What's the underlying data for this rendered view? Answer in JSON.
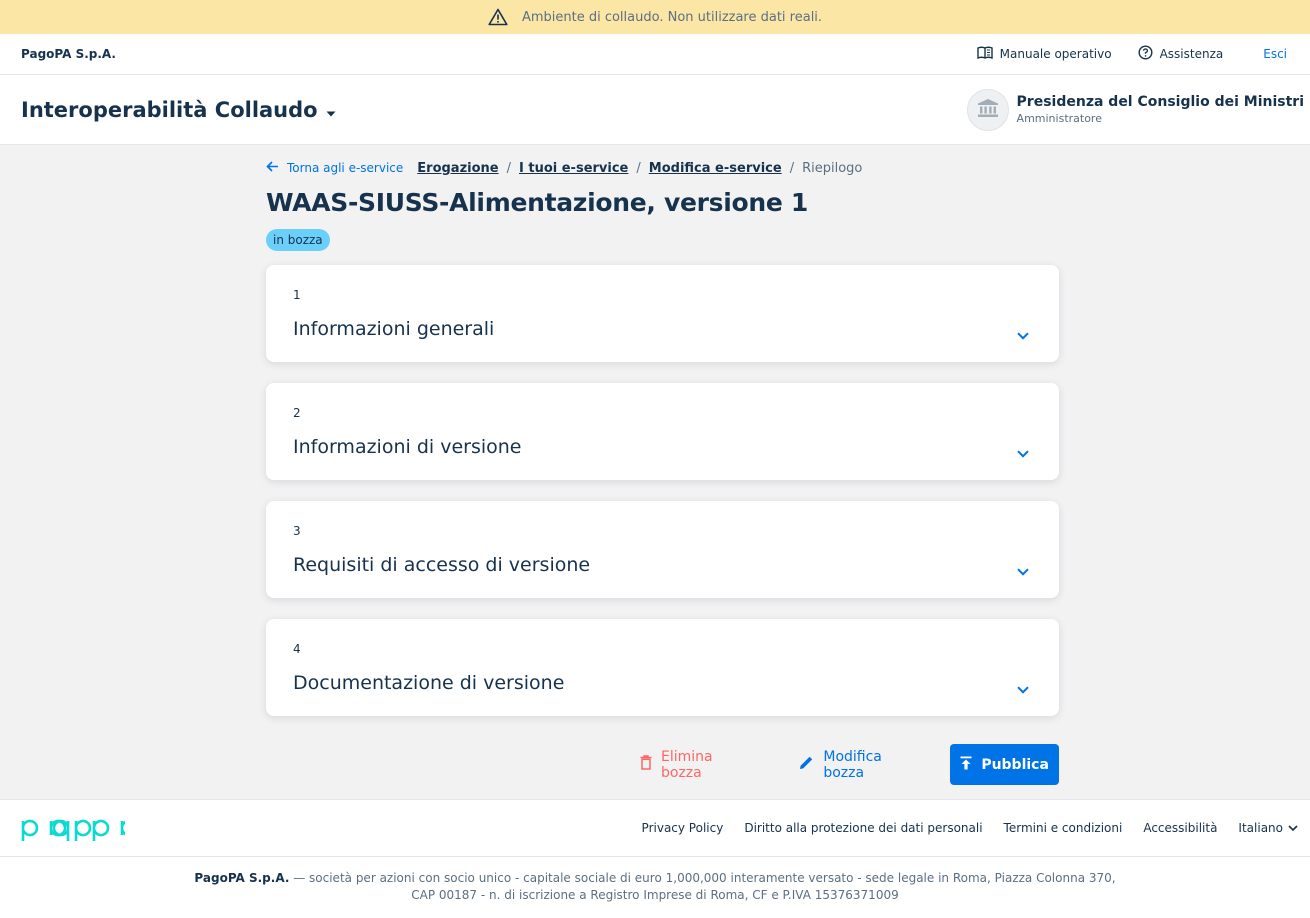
{
  "banner": {
    "text": "Ambiente di collaudo. Non utilizzare dati reali."
  },
  "topbar": {
    "brand": "PagoPA S.p.A.",
    "manual": "Manuale operativo",
    "help": "Assistenza",
    "exit": "Esci"
  },
  "header": {
    "product": "Interoperabilità Collaudo",
    "party_name": "Presidenza del Consiglio dei Ministri",
    "party_role": "Amministratore"
  },
  "breadcrumb": {
    "back": "Torna agli e-service",
    "items": [
      "Erogazione",
      "I tuoi e-service",
      "Modifica e-service"
    ],
    "current": "Riepilogo"
  },
  "page": {
    "title": "WAAS-SIUSS-Alimentazione, versione 1",
    "status": "in bozza"
  },
  "sections": [
    {
      "num": "1",
      "title": "Informazioni generali"
    },
    {
      "num": "2",
      "title": "Informazioni di versione"
    },
    {
      "num": "3",
      "title": "Requisiti di accesso di versione"
    },
    {
      "num": "4",
      "title": "Documentazione di versione"
    }
  ],
  "actions": {
    "delete": "Elimina bozza",
    "edit": "Modifica bozza",
    "publish": "Pubblica"
  },
  "footer": {
    "links": [
      "Privacy Policy",
      "Diritto alla protezione dei dati personali",
      "Termini e condizioni",
      "Accessibilità"
    ],
    "language": "Italiano",
    "company": "PagoPA S.p.A.",
    "legal_1": " — società per azioni con socio unico - capitale sociale di euro 1,000,000 interamente versato - sede legale in Roma, Piazza Colonna 370,",
    "legal_2": "CAP 00187 - n. di iscrizione a Registro Imprese di Roma, CF e P.IVA 15376371009"
  },
  "colors": {
    "primary": "#0073e6",
    "text": "#17324d",
    "error": "#fe6666",
    "warning_bg": "#fbe6a6",
    "badge": "#6bcffb",
    "logo": "#0bd9d2"
  },
  "icons": [
    "warning-icon",
    "book-icon",
    "help-icon",
    "caret-down-icon",
    "institution-icon",
    "arrow-left-icon",
    "chevron-down-icon",
    "trash-icon",
    "pencil-icon",
    "publish-icon"
  ]
}
